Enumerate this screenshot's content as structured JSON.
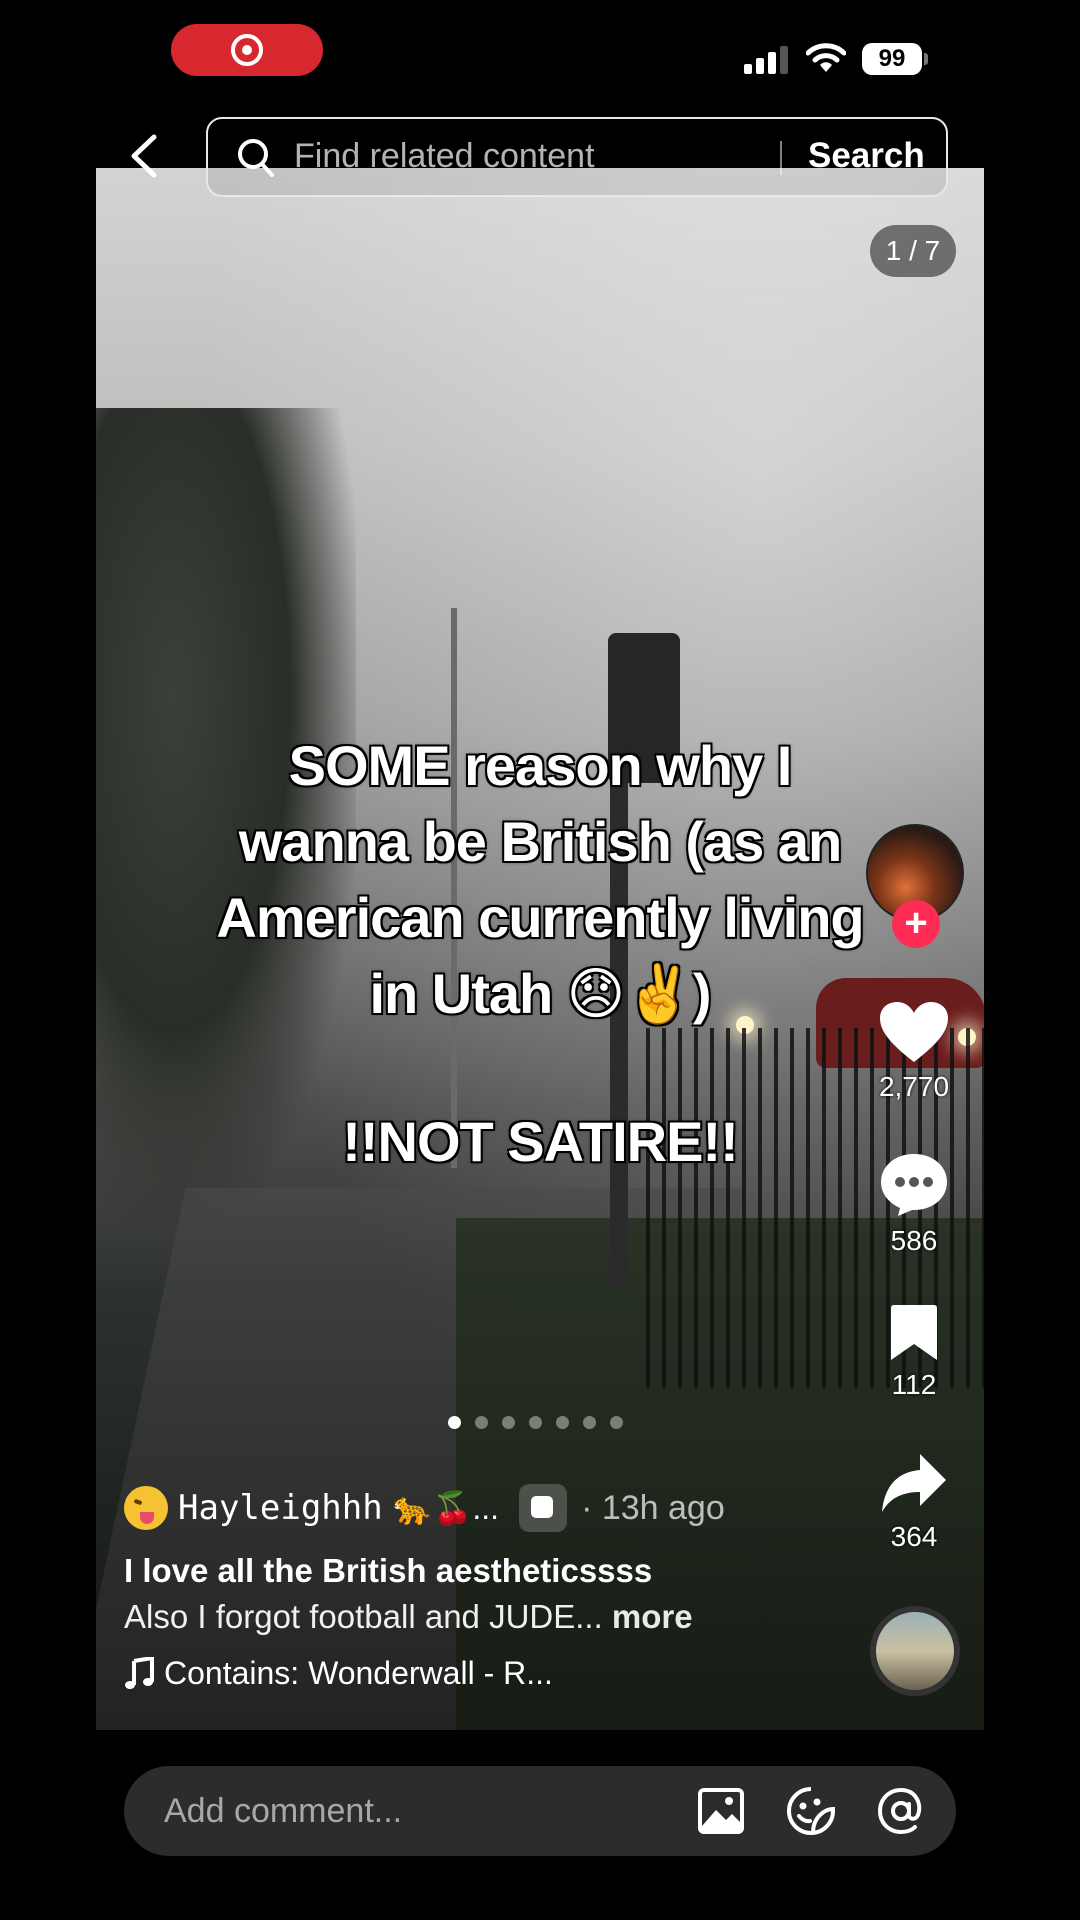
{
  "status_bar": {
    "recording_icon": "screen-record-icon",
    "battery": "99"
  },
  "top_nav": {
    "back_icon": "chevron-left-icon",
    "search_placeholder": "Find related content",
    "search_button": "Search"
  },
  "post": {
    "page_counter": "1 / 7",
    "overlay_line1": "SOME reason why I",
    "overlay_line2": "wanna be British (as an",
    "overlay_line3": "American currently living",
    "overlay_line4": "in Utah 😞✌️)",
    "overlay_line5": "!!NOT SATIRE!!",
    "slides_total": 7,
    "slide_active": 1
  },
  "rail": {
    "likes": "2,770",
    "comments": "586",
    "saves": "112",
    "shares": "364"
  },
  "author": {
    "name": "Hayleighhh",
    "name_suffix": "🐆🍒...",
    "time": "· 13h ago"
  },
  "caption": {
    "title": "I love all the British aestheticssss",
    "body": "Also I forgot football and JUDE...",
    "more": "more"
  },
  "sound": {
    "label": "Contains: Wonderwall - R..."
  },
  "comment_bar": {
    "placeholder": "Add comment..."
  }
}
